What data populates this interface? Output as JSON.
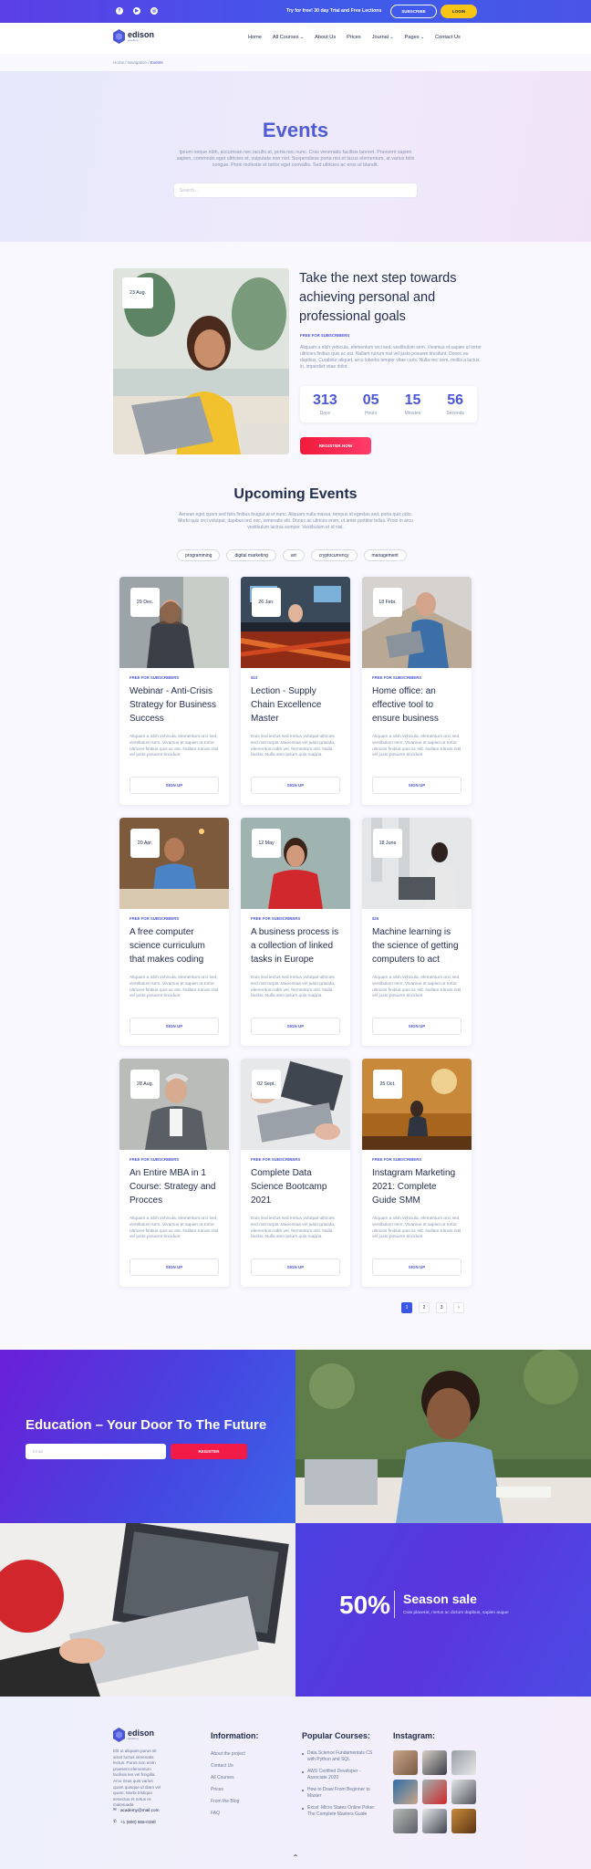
{
  "topbar": {
    "promo": "Try for free! 30 day Trial and Free Lections",
    "subscribe": "SUBSCRIBE",
    "login": "LOGIN",
    "socials": [
      "facebook-icon",
      "youtube-icon",
      "instagram-icon"
    ]
  },
  "header": {
    "logo_name": "edison",
    "logo_sub": "academy",
    "nav": [
      "Home",
      "All Courses",
      "About Us",
      "Prices",
      "Journal",
      "Pages",
      "Contact Us"
    ]
  },
  "breadcrumb": {
    "home": "Home",
    "sep": " / ",
    "nav": "Navigation",
    "current": "Events"
  },
  "hero": {
    "title": "Events",
    "text": "Ipsum neque nibh, accumsan nec iaculis at, porta nec nunc. Cras venenatis facilisis laoreet. Praesent sapien sapien, commodo eget ultricies et, vulputate non nisl. Suspendisse porta nisi et lacus elementum, at varius felis congue. Proin molestie et tortor eget convallis. Sed ultricies ac eros ut blandit.",
    "search_placeholder": "Search..."
  },
  "featured": {
    "date": "23 Aug.",
    "title": "Take the next step towards achieving personal and professional goals",
    "tag": "FREE FOR SUBSCRIBERS",
    "text": "Aliquam a nibh vehicula, elementum orci sed, vestibulum sem. Vivamus et sapien ut tortor ultricies finibus quis ac est. Nullam rutrum nisl vel justo posuere tincidunt. Donec eu dapibus. Curabitur aliquet, arcu lobortis tempor vitae curis. Nulla nec sem, mollis a luctus in, imperdiet vitae dolor.",
    "countdown": [
      {
        "num": "313",
        "label": "Days"
      },
      {
        "num": "05",
        "label": "Hours"
      },
      {
        "num": "15",
        "label": "Minutes"
      },
      {
        "num": "56",
        "label": "Seconds"
      }
    ],
    "button": "REGISTER NOW"
  },
  "upcoming": {
    "title": "Upcoming Events",
    "text": "Aenean eget quam sed felis finibus feugiat at et nunc. Aliquam nulla massa, tempus id egestas sed, porta quis odio. Morbi quis orci volutpat, dapibus orci nec, venenatis elit. Donec ac ultrices enim, ut amet porttitor tellus. Proin in arcu vestibulum lacinia semper. Vestibulum et id nisl.",
    "chips": [
      "programming",
      "digital marketing",
      "art",
      "cryptocurrency",
      "management"
    ],
    "cards": [
      {
        "date": "29 Dec.",
        "tag": "FREE FOR SUBSCRIBERS",
        "title": "Webinar - Anti-Crisis Strategy for Business Success",
        "text": "Aliquam a nibh vehicula, elementum orci sed, vestibulum sem. Vivamus et sapien ut tortor ultricies finibus quis ac est. Nullam rutrum nisl vel justo posuere tincidunt",
        "button": "SIGN UP"
      },
      {
        "date": "26 Jan.",
        "tag": "$13",
        "title": "Lection - Supply Chain Excellence Master",
        "text": "Duis sed lectus sed metus volutpat ultricies sed non turpis. Maecenas vel justo gravida, elementum nibh vel, fermentum nisi. Nulla facilisi. Nulla sem ipsum quis magna.",
        "button": "SIGN UP"
      },
      {
        "date": "18 Febr.",
        "tag": "FREE FOR SUBSCRIBERS",
        "title": "Home office: an effective tool to ensure business",
        "text": "Aliquam a nibh vehicula, elementum orci sed, vestibulum sem. Vivamus et sapien ut tortor ultricies finibus quis ac est. Nullam rutrum nisl vel justo posuere tincidunt",
        "button": "SIGN UP"
      },
      {
        "date": "20 Apr.",
        "tag": "FREE FOR SUBSCRIBERS",
        "title": "A free computer science curriculum that makes coding",
        "text": "Aliquam a nibh vehicula, elementum orci sed, vestibulum sem. Vivamus et sapien ut tortor ultricies finibus quis ac est. Nullam rutrum nisl vel justo posuere tincidunt",
        "button": "SIGN UP"
      },
      {
        "date": "12 May",
        "tag": "FREE FOR SUBSCRIBERS",
        "title": "A business process is a collection of linked tasks in Europe",
        "text": "Duis sed lectus sed metus volutpat ultricies sed non turpis. Maecenas vel justo gravida, elementum nibh vel, fermentum nisi. Nulla facilisi. Nulla sem ipsum quis magna.",
        "button": "SIGN UP"
      },
      {
        "date": "18 June",
        "tag": "$25",
        "title": "Machine learning is the science of getting computers to act",
        "text": "Aliquam a nibh vehicula, elementum orci sed, vestibulum sem. Vivamus et sapien ut tortor ultricies finibus quis ac est. Nullam rutrum nisl vel justo posuere tincidunt",
        "button": "SIGN UP"
      },
      {
        "date": "28 Aug.",
        "tag": "FREE FOR SUBSCRIBERS",
        "title": "An Entire MBA in 1 Course: Strategy and Procces",
        "text": "Aliquam a nibh vehicula, elementum orci sed, vestibulum sem. Vivamus et sapien ut tortor ultricies finibus quis ac est. Nullam rutrum nisl vel justo posuere tincidunt",
        "button": "SIGN UP"
      },
      {
        "date": "02 Sept.",
        "tag": "FREE FOR SUBSCRIBERS",
        "title": "Complete Data Science Bootcamp 2021",
        "text": "Duis sed lectus sed metus volutpat ultricies sed non turpis. Maecenas vel justo gravida, elementum nibh vel, fermentum nisi. Nulla facilisi. Nulla sem ipsum quis magna.",
        "button": "SIGN UP"
      },
      {
        "date": "25 Oct.",
        "tag": "FREE FOR SUBSCRIBERS",
        "title": "Instagram Marketing 2021: Complete Guide SMM",
        "text": "Aliquam a nibh vehicula, elementum orci sed, vestibulum sem. Vivamus et sapien ut tortor ultricies finibus quis ac est. Nullam rutrum nisl vel justo posuere tincidunt",
        "button": "SIGN UP"
      }
    ],
    "pages": [
      "1",
      "2",
      "3",
      "›"
    ]
  },
  "cta": {
    "title": "Education – Your Door To The Future",
    "email_placeholder": "Email",
    "button": "REGISTER"
  },
  "sale": {
    "num": "50%",
    "title": "Season sale",
    "subtitle": "Cras placerat, metus ac dictum dapibus, sapien augue"
  },
  "footer": {
    "about": "Elit ut aliquam purus sit amet luctus venenatis lectus. Purus non enim praesent elementum facilisis leo vel fringilla. Arcu risus quis varius quam quisque id diam vel quam. Morbi tristique senectus et netus et malesuada",
    "email": "academy@mail.com",
    "phone": "+1 (800) 555-0190",
    "info_title": "Information:",
    "info_links": [
      "About the project",
      "Contact Us",
      "All Courses",
      "Prices",
      "From the Blog",
      "FAQ"
    ],
    "courses_title": "Popular Courses:",
    "courses": [
      "Data Science Fundamentals CS with Python and SQL",
      "AWS Certified Developer - Associate 2020",
      "How to Draw From Beginner to Master",
      "Excel: Micro States Online Poker: The Complete Masters Guide"
    ],
    "insta_title": "Instagram:"
  },
  "colors": {
    "primary": "#4b56d7",
    "accent_red": "#f21a46",
    "accent_yellow": "#f6c515",
    "dark": "#232d4f"
  }
}
